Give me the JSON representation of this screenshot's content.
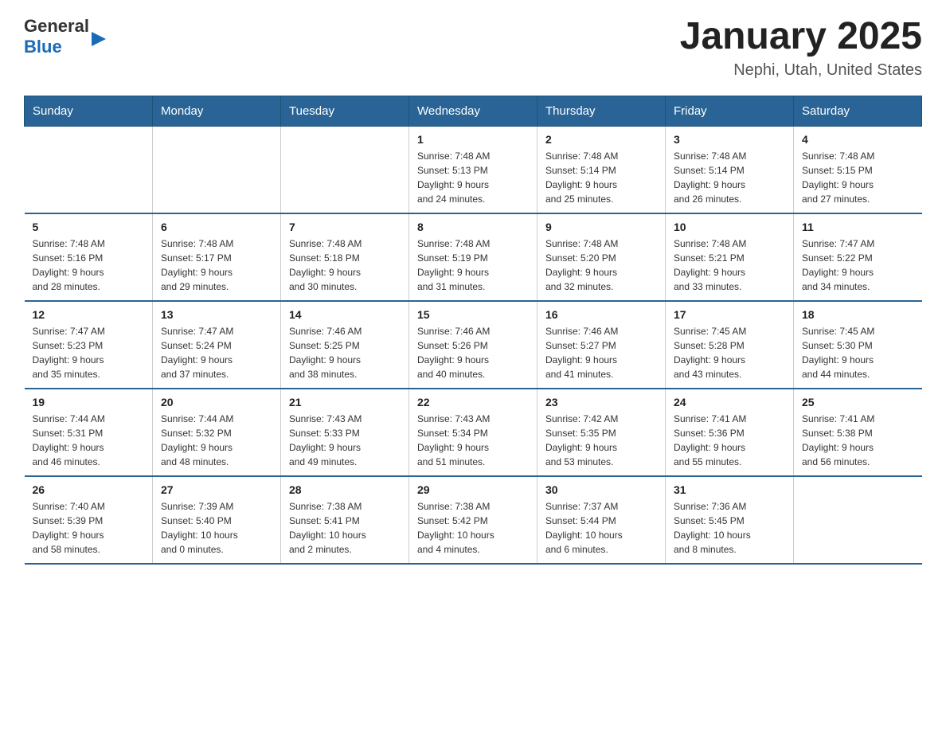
{
  "header": {
    "logo_text_general": "General",
    "logo_text_blue": "Blue",
    "month_title": "January 2025",
    "location": "Nephi, Utah, United States"
  },
  "days_of_week": [
    "Sunday",
    "Monday",
    "Tuesday",
    "Wednesday",
    "Thursday",
    "Friday",
    "Saturday"
  ],
  "weeks": [
    [
      {
        "day": "",
        "info": ""
      },
      {
        "day": "",
        "info": ""
      },
      {
        "day": "",
        "info": ""
      },
      {
        "day": "1",
        "info": "Sunrise: 7:48 AM\nSunset: 5:13 PM\nDaylight: 9 hours\nand 24 minutes."
      },
      {
        "day": "2",
        "info": "Sunrise: 7:48 AM\nSunset: 5:14 PM\nDaylight: 9 hours\nand 25 minutes."
      },
      {
        "day": "3",
        "info": "Sunrise: 7:48 AM\nSunset: 5:14 PM\nDaylight: 9 hours\nand 26 minutes."
      },
      {
        "day": "4",
        "info": "Sunrise: 7:48 AM\nSunset: 5:15 PM\nDaylight: 9 hours\nand 27 minutes."
      }
    ],
    [
      {
        "day": "5",
        "info": "Sunrise: 7:48 AM\nSunset: 5:16 PM\nDaylight: 9 hours\nand 28 minutes."
      },
      {
        "day": "6",
        "info": "Sunrise: 7:48 AM\nSunset: 5:17 PM\nDaylight: 9 hours\nand 29 minutes."
      },
      {
        "day": "7",
        "info": "Sunrise: 7:48 AM\nSunset: 5:18 PM\nDaylight: 9 hours\nand 30 minutes."
      },
      {
        "day": "8",
        "info": "Sunrise: 7:48 AM\nSunset: 5:19 PM\nDaylight: 9 hours\nand 31 minutes."
      },
      {
        "day": "9",
        "info": "Sunrise: 7:48 AM\nSunset: 5:20 PM\nDaylight: 9 hours\nand 32 minutes."
      },
      {
        "day": "10",
        "info": "Sunrise: 7:48 AM\nSunset: 5:21 PM\nDaylight: 9 hours\nand 33 minutes."
      },
      {
        "day": "11",
        "info": "Sunrise: 7:47 AM\nSunset: 5:22 PM\nDaylight: 9 hours\nand 34 minutes."
      }
    ],
    [
      {
        "day": "12",
        "info": "Sunrise: 7:47 AM\nSunset: 5:23 PM\nDaylight: 9 hours\nand 35 minutes."
      },
      {
        "day": "13",
        "info": "Sunrise: 7:47 AM\nSunset: 5:24 PM\nDaylight: 9 hours\nand 37 minutes."
      },
      {
        "day": "14",
        "info": "Sunrise: 7:46 AM\nSunset: 5:25 PM\nDaylight: 9 hours\nand 38 minutes."
      },
      {
        "day": "15",
        "info": "Sunrise: 7:46 AM\nSunset: 5:26 PM\nDaylight: 9 hours\nand 40 minutes."
      },
      {
        "day": "16",
        "info": "Sunrise: 7:46 AM\nSunset: 5:27 PM\nDaylight: 9 hours\nand 41 minutes."
      },
      {
        "day": "17",
        "info": "Sunrise: 7:45 AM\nSunset: 5:28 PM\nDaylight: 9 hours\nand 43 minutes."
      },
      {
        "day": "18",
        "info": "Sunrise: 7:45 AM\nSunset: 5:30 PM\nDaylight: 9 hours\nand 44 minutes."
      }
    ],
    [
      {
        "day": "19",
        "info": "Sunrise: 7:44 AM\nSunset: 5:31 PM\nDaylight: 9 hours\nand 46 minutes."
      },
      {
        "day": "20",
        "info": "Sunrise: 7:44 AM\nSunset: 5:32 PM\nDaylight: 9 hours\nand 48 minutes."
      },
      {
        "day": "21",
        "info": "Sunrise: 7:43 AM\nSunset: 5:33 PM\nDaylight: 9 hours\nand 49 minutes."
      },
      {
        "day": "22",
        "info": "Sunrise: 7:43 AM\nSunset: 5:34 PM\nDaylight: 9 hours\nand 51 minutes."
      },
      {
        "day": "23",
        "info": "Sunrise: 7:42 AM\nSunset: 5:35 PM\nDaylight: 9 hours\nand 53 minutes."
      },
      {
        "day": "24",
        "info": "Sunrise: 7:41 AM\nSunset: 5:36 PM\nDaylight: 9 hours\nand 55 minutes."
      },
      {
        "day": "25",
        "info": "Sunrise: 7:41 AM\nSunset: 5:38 PM\nDaylight: 9 hours\nand 56 minutes."
      }
    ],
    [
      {
        "day": "26",
        "info": "Sunrise: 7:40 AM\nSunset: 5:39 PM\nDaylight: 9 hours\nand 58 minutes."
      },
      {
        "day": "27",
        "info": "Sunrise: 7:39 AM\nSunset: 5:40 PM\nDaylight: 10 hours\nand 0 minutes."
      },
      {
        "day": "28",
        "info": "Sunrise: 7:38 AM\nSunset: 5:41 PM\nDaylight: 10 hours\nand 2 minutes."
      },
      {
        "day": "29",
        "info": "Sunrise: 7:38 AM\nSunset: 5:42 PM\nDaylight: 10 hours\nand 4 minutes."
      },
      {
        "day": "30",
        "info": "Sunrise: 7:37 AM\nSunset: 5:44 PM\nDaylight: 10 hours\nand 6 minutes."
      },
      {
        "day": "31",
        "info": "Sunrise: 7:36 AM\nSunset: 5:45 PM\nDaylight: 10 hours\nand 8 minutes."
      },
      {
        "day": "",
        "info": ""
      }
    ]
  ]
}
